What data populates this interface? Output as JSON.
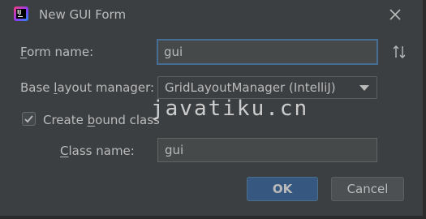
{
  "window": {
    "title": "New GUI Form",
    "icon": "intellij-idea-icon",
    "icon_text": "IJ"
  },
  "form": {
    "form_name_label": "Form name:",
    "form_name_value": "gui",
    "base_layout_label": "Base layout manager:",
    "base_layout_value": "GridLayoutManager (IntelliJ)",
    "create_bound_class_label": "Create bound class",
    "create_bound_class_checked": true,
    "class_name_label": "Class name:",
    "class_name_value": "gui"
  },
  "buttons": {
    "ok_label": "OK",
    "cancel_label": "Cancel"
  },
  "watermark": {
    "text": "javatiku.cn"
  },
  "colors": {
    "background": "#3c3f41",
    "text": "#bbbbbb",
    "focus_border": "#466d94",
    "ok_button": "#365880"
  }
}
